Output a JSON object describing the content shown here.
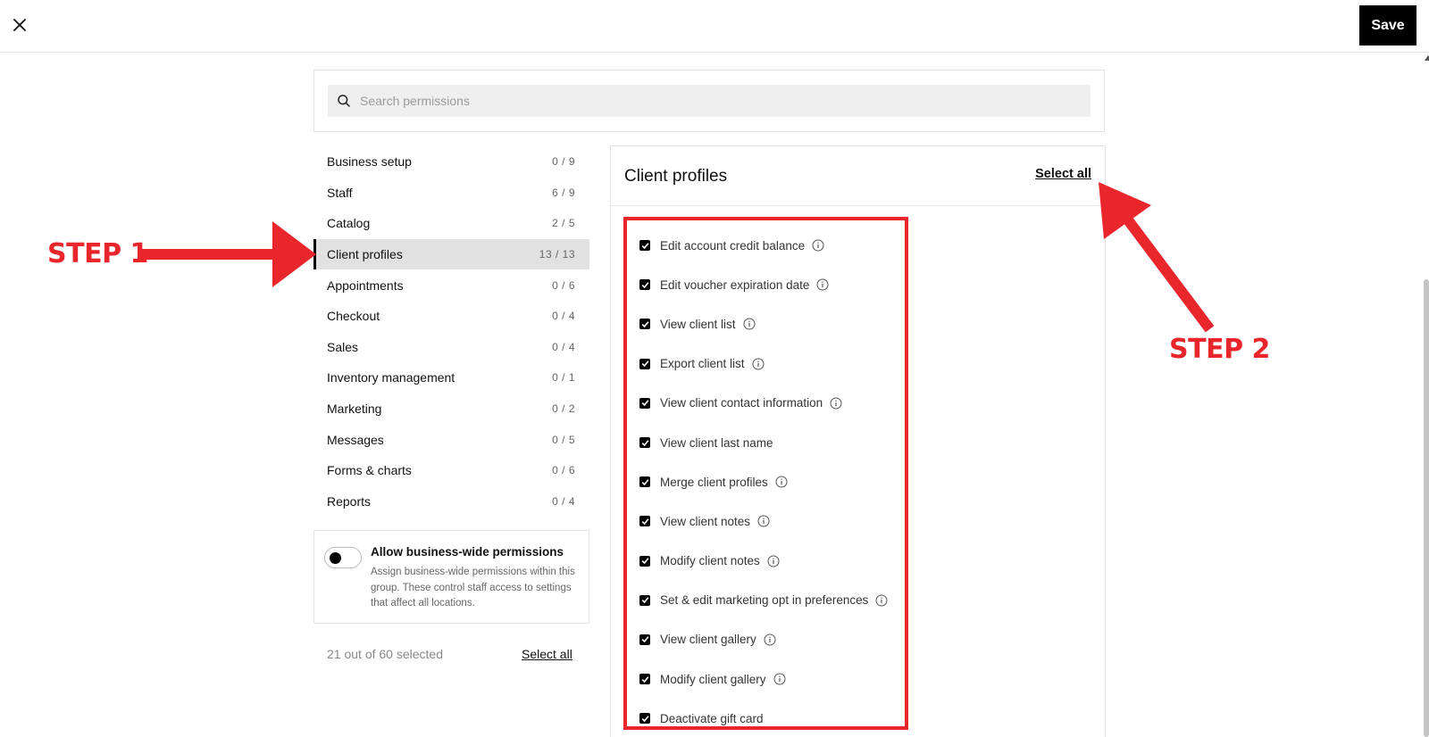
{
  "topbar": {
    "close_icon": "close-icon",
    "save_label": "Save"
  },
  "search": {
    "placeholder": "Search permissions",
    "value": ""
  },
  "categories": [
    {
      "label": "Business setup",
      "count": "0 / 9"
    },
    {
      "label": "Staff",
      "count": "6 / 9"
    },
    {
      "label": "Catalog",
      "count": "2 / 5"
    },
    {
      "label": "Client profiles",
      "count": "13 / 13"
    },
    {
      "label": "Appointments",
      "count": "0 / 6"
    },
    {
      "label": "Checkout",
      "count": "0 / 4"
    },
    {
      "label": "Sales",
      "count": "0 / 4"
    },
    {
      "label": "Inventory management",
      "count": "0 / 1"
    },
    {
      "label": "Marketing",
      "count": "0 / 2"
    },
    {
      "label": "Messages",
      "count": "0 / 5"
    },
    {
      "label": "Forms & charts",
      "count": "0 / 6"
    },
    {
      "label": "Reports",
      "count": "0 / 4"
    }
  ],
  "business_wide": {
    "title": "Allow business-wide permissions",
    "description": "Assign business-wide permissions within this group. These control staff access to settings that affect all locations.",
    "enabled": false
  },
  "footer": {
    "selected_text": "21 out of 60 selected",
    "select_all_label": "Select all"
  },
  "panel": {
    "title": "Client profiles",
    "select_all_label": "Select all",
    "permissions": [
      {
        "label": "Edit account credit balance",
        "checked": true,
        "info": true
      },
      {
        "label": "Edit voucher expiration date",
        "checked": true,
        "info": true
      },
      {
        "label": "View client list",
        "checked": true,
        "info": true
      },
      {
        "label": "Export client list",
        "checked": true,
        "info": true
      },
      {
        "label": "View client contact information",
        "checked": true,
        "info": true
      },
      {
        "label": "View client last name",
        "checked": true,
        "info": false
      },
      {
        "label": "Merge client profiles",
        "checked": true,
        "info": true
      },
      {
        "label": "View client notes",
        "checked": true,
        "info": true
      },
      {
        "label": "Modify client notes",
        "checked": true,
        "info": true
      },
      {
        "label": "Set & edit marketing opt in preferences",
        "checked": true,
        "info": true
      },
      {
        "label": "View client gallery",
        "checked": true,
        "info": true
      },
      {
        "label": "Modify client gallery",
        "checked": true,
        "info": true
      },
      {
        "label": "Deactivate gift card",
        "checked": true,
        "info": false
      }
    ]
  },
  "annotations": {
    "step1": "STEP 1",
    "step2": "STEP 2",
    "color": "#e8262b"
  }
}
